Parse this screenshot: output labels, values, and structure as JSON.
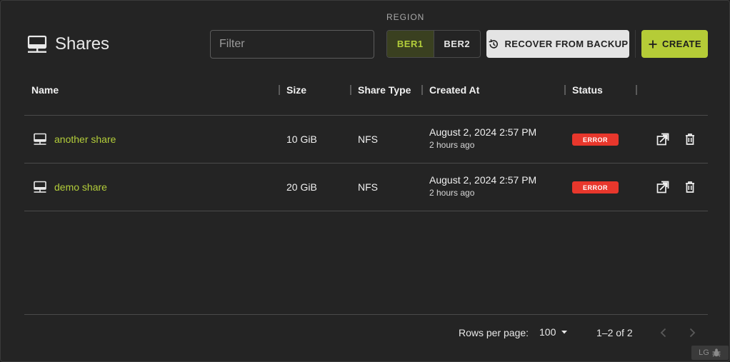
{
  "header": {
    "title": "Shares",
    "icon": "network-share-icon"
  },
  "filter": {
    "placeholder": "Filter",
    "value": ""
  },
  "region": {
    "label": "REGION",
    "options": [
      "BER1",
      "BER2"
    ],
    "selected": "BER1"
  },
  "actions": {
    "recover_label": "RECOVER FROM BACKUP",
    "create_label": "CREATE"
  },
  "table": {
    "columns": [
      "Name",
      "Size",
      "Share Type",
      "Created At",
      "Status"
    ],
    "rows": [
      {
        "name": "another share",
        "size": "10 GiB",
        "type": "NFS",
        "created": "August 2, 2024 2:57 PM",
        "created_relative": "2 hours ago",
        "status": "ERROR"
      },
      {
        "name": "demo share",
        "size": "20 GiB",
        "type": "NFS",
        "created": "August 2, 2024 2:57 PM",
        "created_relative": "2 hours ago",
        "status": "ERROR"
      }
    ]
  },
  "pagination": {
    "rows_per_page_label": "Rows per page:",
    "rows_per_page": "100",
    "range": "1–2 of 2"
  },
  "corner_badge": {
    "label": "LG",
    "icon": "bug-icon"
  },
  "colors": {
    "accent": "#b5cc37",
    "error": "#e8372c",
    "background": "#242424"
  }
}
